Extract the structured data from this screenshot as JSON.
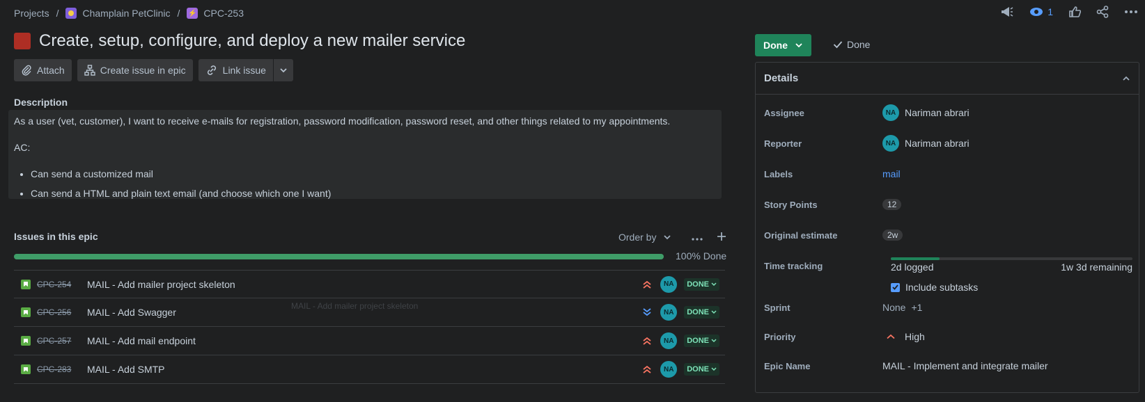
{
  "breadcrumb": {
    "projects": "Projects",
    "project": "Champlain PetClinic",
    "issue_key": "CPC-253",
    "separator": "/"
  },
  "toolbar": {
    "watch_count": "1"
  },
  "issue": {
    "title": "Create, setup, configure, and deploy a new mailer service",
    "type_color": "#ae2e24"
  },
  "actions": {
    "attach": "Attach",
    "create_in_epic": "Create issue in epic",
    "link_issue": "Link issue"
  },
  "description": {
    "label": "Description",
    "paragraph": "As a user (vet, customer), I want to receive e-mails for registration, password modification, password reset, and other things related to my appointments.",
    "ac": "AC:",
    "bullets": [
      "Can send a customized mail",
      "Can send a HTML and plain text email (and choose which one I want)"
    ]
  },
  "epic_issues": {
    "label": "Issues in this epic",
    "order_by": "Order by",
    "progress_percent": 100,
    "progress_text": "100% Done",
    "items": [
      {
        "key": "CPC-254",
        "summary": "MAIL - Add mailer project skeleton",
        "priority": "highest",
        "assignee_initials": "NA",
        "status": "DONE"
      },
      {
        "key": "CPC-256",
        "summary": "MAIL - Add Swagger",
        "priority": "lowest",
        "assignee_initials": "NA",
        "status": "DONE"
      },
      {
        "key": "CPC-257",
        "summary": "MAIL - Add mail endpoint",
        "priority": "highest",
        "assignee_initials": "NA",
        "status": "DONE"
      },
      {
        "key": "CPC-283",
        "summary": "MAIL - Add SMTP",
        "priority": "highest",
        "assignee_initials": "NA",
        "status": "DONE"
      }
    ],
    "ghost_text": "MAIL - Add mailer project skeleton"
  },
  "status": {
    "button": "Done",
    "resolution": "Done",
    "color": "#1f845a"
  },
  "details": {
    "title": "Details",
    "assignee_label": "Assignee",
    "assignee": "Nariman abrari",
    "assignee_initials": "NA",
    "reporter_label": "Reporter",
    "reporter": "Nariman abrari",
    "reporter_initials": "NA",
    "labels_label": "Labels",
    "labels_value": "mail",
    "story_points_label": "Story Points",
    "story_points": "12",
    "original_estimate_label": "Original estimate",
    "original_estimate": "2w",
    "time_tracking_label": "Time tracking",
    "time_logged": "2d logged",
    "time_remaining": "1w 3d remaining",
    "include_subtasks": "Include subtasks",
    "sprint_label": "Sprint",
    "sprint": "None",
    "sprint_extra": "+1",
    "priority_label": "Priority",
    "priority": "High",
    "epic_name_label": "Epic Name",
    "epic_name": "MAIL - Implement and integrate mailer"
  }
}
